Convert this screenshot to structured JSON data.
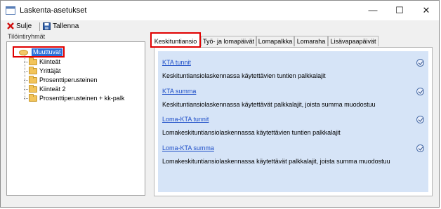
{
  "window": {
    "title": "Laskenta-asetukset",
    "controls": {
      "minimize": "—",
      "maximize": "☐",
      "close": "✕"
    }
  },
  "toolbar": {
    "close_label": "Sulje",
    "save_label": "Tallenna"
  },
  "tree": {
    "label": "Tilöintiryhmät",
    "selected": "Muuttuvat",
    "items": [
      {
        "label": "Kiinteät"
      },
      {
        "label": "Yrittäjät"
      },
      {
        "label": "Prosenttiperusteinen"
      },
      {
        "label": "Kiinteät 2"
      },
      {
        "label": "Prosenttiperusteinen + kk-palk"
      }
    ]
  },
  "tabs": [
    {
      "label": "Keskituntiansio",
      "active": true
    },
    {
      "label": "Työ- ja lomapäivät"
    },
    {
      "label": "Lomapalkka"
    },
    {
      "label": "Lomaraha"
    },
    {
      "label": "Lisävapaapäivät"
    }
  ],
  "entries": [
    {
      "link": "KTA tunnit",
      "description": "Keskituntiansiolaskennassa käytettävien tuntien palkkalajit",
      "checked": true
    },
    {
      "link": "KTA summa",
      "description": "Keskituntiansiolaskennassa käytettävät palkkalajit, joista summa muodostuu",
      "checked": true
    },
    {
      "link": "Loma-KTA tunnit",
      "description": "Lomakeskituntiansiolaskennassa käytettävien tuntien palkkalajit",
      "checked": true
    },
    {
      "link": "Loma-KTA summa",
      "description": "Lomakeskituntiansiolaskennassa käytettävät palkkalajit, joista summa muodostuu",
      "checked": true
    }
  ],
  "colors": {
    "panel_background": "#d6e4f7",
    "highlight_border": "#e00000",
    "selection": "#2a6fdb",
    "link": "#1f4fc8"
  }
}
